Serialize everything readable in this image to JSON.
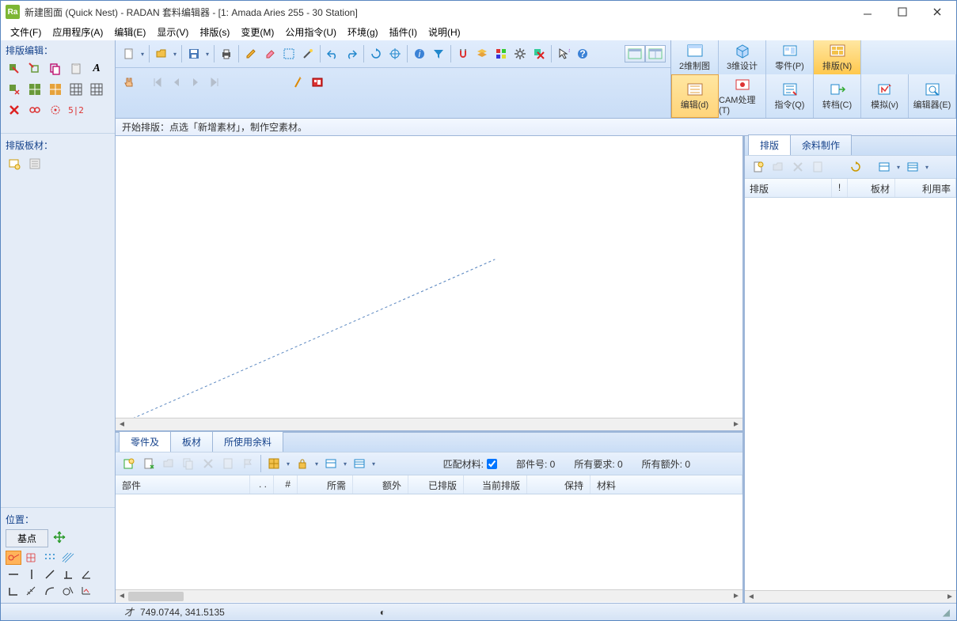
{
  "window": {
    "title": "新建图面 (Quick Nest) - RADAN 套料编辑器 - [1: Amada Aries 255 - 30 Station]",
    "logo": "Ra"
  },
  "menu": {
    "file": "文件(F)",
    "app": "应用程序(A)",
    "edit": "编辑(E)",
    "view": "显示(V)",
    "nest": "排版(s)",
    "change": "变更(M)",
    "public": "公用指令(U)",
    "env": "环境(g)",
    "plugin": "插件(I)",
    "help": "说明(H)"
  },
  "left": {
    "t1": "排版编辑：",
    "t2": "排版板材：",
    "t3": "位置：",
    "base": "基点"
  },
  "hint": "开始排版：点选「新增素材」，制作空素材。",
  "bigtabs": {
    "r1": {
      "a": "2维制图",
      "b": "3维设计",
      "c": "零件(P)",
      "d": "排版(N)"
    },
    "r2": {
      "a": "编辑(d)",
      "b": "CAM处理(T)",
      "c": "指令(Q)",
      "d": "转档(C)",
      "e": "模拟(v)",
      "f": "编辑器(E)"
    }
  },
  "bottomTabs": {
    "a": "零件及",
    "b": "板材",
    "c": "所使用余料"
  },
  "bottomToolbar": {
    "match": "匹配材料:",
    "partno": "部件号: 0",
    "req": "所有要求: 0",
    "extra": "所有额外: 0"
  },
  "bottomCols": {
    "part": "部件",
    "dots": ". .",
    "hash": "#",
    "need": "所需",
    "extra": "额外",
    "nested": "已排版",
    "current": "当前排版",
    "keep": "保持",
    "mat": "材料"
  },
  "rightTabs": {
    "a": "排版",
    "b": "余料制作"
  },
  "rightCols": {
    "a": "排版",
    "b": "!",
    "c": "板材",
    "d": "利用率"
  },
  "status": {
    "cursor_icon": "才",
    "coords": "749.0744, 341.5135"
  }
}
